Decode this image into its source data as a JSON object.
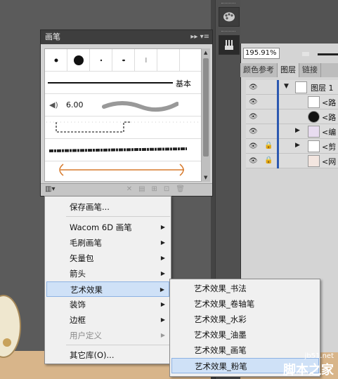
{
  "brush_panel": {
    "title": "画笔",
    "title_buttons": "▸▸ ▾≡",
    "basic_label": "基本",
    "size_value": "6.00"
  },
  "right_panel": {
    "zoom": "195.91%",
    "tabs": [
      "颜色参考",
      "图层",
      "链接"
    ],
    "layers": [
      {
        "name": "图层 1"
      },
      {
        "name": "<路"
      },
      {
        "name": "<路"
      },
      {
        "name": "<编"
      },
      {
        "name": "<剪"
      },
      {
        "name": "<网"
      }
    ]
  },
  "menu": {
    "items": [
      {
        "label": "保存画笔..."
      },
      {
        "label": "Wacom 6D 画笔"
      },
      {
        "label": "毛刷画笔"
      },
      {
        "label": "矢量包"
      },
      {
        "label": "箭头"
      },
      {
        "label": "艺术效果"
      },
      {
        "label": "装饰"
      },
      {
        "label": "边框"
      },
      {
        "label": "用户定义"
      },
      {
        "label": "其它库(O)..."
      }
    ]
  },
  "submenu": {
    "items": [
      {
        "label": "艺术效果_书法"
      },
      {
        "label": "艺术效果_卷轴笔"
      },
      {
        "label": "艺术效果_水彩"
      },
      {
        "label": "艺术效果_油墨"
      },
      {
        "label": "艺术效果_画笔"
      },
      {
        "label": "艺术效果_粉笔"
      }
    ]
  },
  "watermark": {
    "url": "jb51.net",
    "name": "脚本之家"
  }
}
